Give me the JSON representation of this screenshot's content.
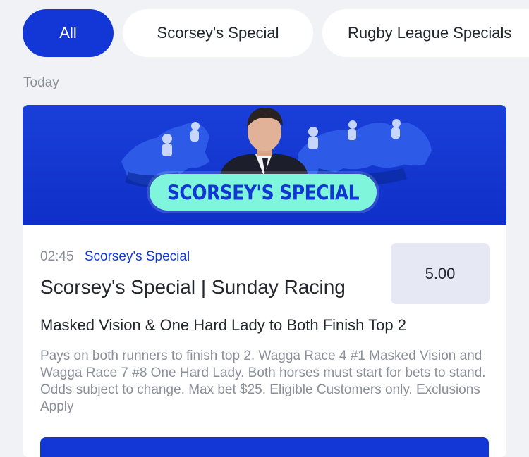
{
  "tabs": [
    {
      "label": "All",
      "active": true
    },
    {
      "label": "Scorsey's Special",
      "active": false
    },
    {
      "label": "Rugby League Specials",
      "active": false
    }
  ],
  "section_label": "Today",
  "card": {
    "banner_title": "SCORSEY'S SPECIAL",
    "time": "02:45",
    "category": "Scorsey's Special",
    "title": "Scorsey's Special | Sunday Racing",
    "odds": "5.00",
    "selection": "Masked Vision & One Hard Lady to Both Finish Top 2",
    "description": "Pays on both runners to finish top 2. Wagga Race 4 #1 Masked Vision and Wagga Race 7 #8 One Hard Lady. Both horses must start for bets to stand. Odds subject to change. Max bet $25. Eligible Customers only. Exclusions Apply"
  },
  "colors": {
    "accent": "#1237d6",
    "banner_pill": "#7ff5dc",
    "background": "#f1f2f6"
  }
}
